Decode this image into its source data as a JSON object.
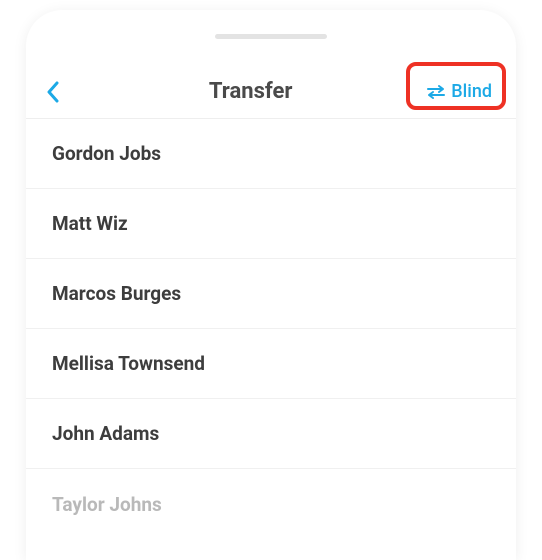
{
  "header": {
    "title": "Transfer",
    "mode_label": "Blind"
  },
  "contacts": {
    "items": [
      {
        "name": "Gordon Jobs"
      },
      {
        "name": "Matt Wiz"
      },
      {
        "name": "Marcos Burges"
      },
      {
        "name": "Mellisa Townsend"
      },
      {
        "name": "John Adams"
      },
      {
        "name": "Taylor Johns"
      }
    ]
  }
}
